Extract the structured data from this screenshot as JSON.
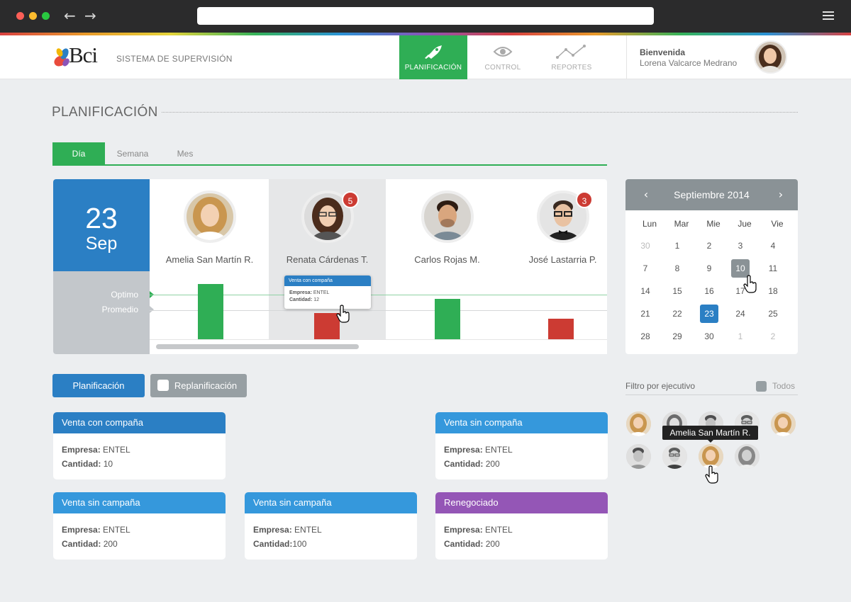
{
  "app": {
    "logo_text": "Bci",
    "system_name": "SISTEMA DE SUPERVISIÓN",
    "nav": [
      {
        "label": "PLANIFICACIÓN",
        "icon": "rocket-icon",
        "active": true
      },
      {
        "label": "CONTROL",
        "icon": "eye-icon",
        "active": false
      },
      {
        "label": "REPORTES",
        "icon": "line-chart-icon",
        "active": false
      }
    ],
    "welcome": "Bienvenida",
    "user_name": "Lorena Valcarce Medrano"
  },
  "page": {
    "title": "PLANIFICACIÓN",
    "tabs": [
      "Día",
      "Semana",
      "Mes"
    ]
  },
  "schedule": {
    "day": "23",
    "month": "Sep",
    "labels": {
      "optimo": "Optimo",
      "promedio": "Promedio"
    },
    "people": [
      {
        "name": "Amelia San Martín R.",
        "badge": "",
        "bar_color": "#2fae55"
      },
      {
        "name": "Renata Cárdenas T.",
        "badge": "5",
        "bar_color": "#cc3b33"
      },
      {
        "name": "Carlos Rojas M.",
        "badge": "",
        "bar_color": "#2fae55"
      },
      {
        "name": "José Lastarria P.",
        "badge": "3",
        "bar_color": "#cc3b33"
      }
    ],
    "tooltip": {
      "title": "Venta con compaña",
      "empresa_label": "Empresa:",
      "empresa": "ENTEL",
      "cantidad_label": "Cantidad:",
      "cantidad": "12"
    }
  },
  "calendar": {
    "month": "Septiembre 2014",
    "weekdays": [
      "Lun",
      "Mar",
      "Mie",
      "Jue",
      "Vie"
    ],
    "weeks": [
      [
        "30",
        "1",
        "2",
        "3",
        "4"
      ],
      [
        "7",
        "8",
        "9",
        "10",
        "11"
      ],
      [
        "14",
        "15",
        "16",
        "17",
        "18"
      ],
      [
        "21",
        "22",
        "23",
        "24",
        "25"
      ],
      [
        "28",
        "29",
        "30",
        "1",
        "2"
      ]
    ],
    "selected": "10",
    "today": "23"
  },
  "actions": {
    "plan": "Planificación",
    "replan": "Replanificación"
  },
  "cards": [
    {
      "title": "Venta con compaña",
      "color": "#2b7fc4",
      "empresa_label": "Empresa:",
      "empresa": "ENTEL",
      "cantidad_label": "Cantidad:",
      "cantidad": "10"
    },
    {
      "title": "Venta sin compaña",
      "color": "#3598dc",
      "empresa_label": "Empresa:",
      "empresa": "ENTEL",
      "cantidad_label": "Cantidad:",
      "cantidad": "200"
    },
    {
      "title": "Venta sin campaña",
      "color": "#3598dc",
      "empresa_label": "Empresa:",
      "empresa": "ENTEL",
      "cantidad_label": "Cantidad:",
      "cantidad": "200"
    },
    {
      "title": "Venta sin campaña",
      "color": "#3598dc",
      "empresa_label": "Empresa:",
      "empresa": "ENTEL",
      "cantidad_label": "Cantidad:",
      "cantidad": "100"
    },
    {
      "title": "Renegociado",
      "color": "#9456b6",
      "empresa_label": "Empresa:",
      "empresa": "ENTEL",
      "cantidad_label": "Cantidad:",
      "cantidad": "200"
    }
  ],
  "filter": {
    "label": "Filtro por ejecutivo",
    "all_label": "Todos",
    "tooltip": "Amelia San Martín R."
  },
  "colors": {
    "green": "#2fae55",
    "blue": "#2b7fc4",
    "red": "#cc3b33",
    "purple": "#9456b6",
    "gray": "#8a9296"
  }
}
